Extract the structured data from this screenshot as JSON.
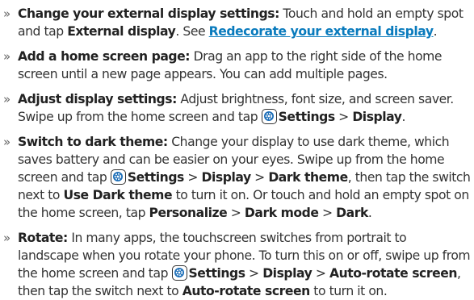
{
  "bullet": "»",
  "items": [
    {
      "title": "Change your external display settings:",
      "t1": " Touch and hold an empty spot and tap ",
      "b1": "External display",
      "t2": ". See ",
      "link": "Redecorate your external display",
      "t3": "."
    },
    {
      "title": "Add a home screen page:",
      "t1": " Drag an app to the right side of the home screen until a new page appears. You can add multiple pages."
    },
    {
      "title": "Adjust display settings:",
      "t1": " Adjust brightness, font size, and screen saver. Swipe up from the home screen and tap ",
      "b1": "Settings",
      "t2": " > ",
      "b2": "Display",
      "t3": "."
    },
    {
      "title": "Switch to dark theme:",
      "t1": " Change your display to use dark theme, which saves battery and can be easier on your eyes. Swipe up from the home screen and tap ",
      "b1": "Settings",
      "t2": " > ",
      "b2": "Display",
      "t3": " > ",
      "b3": "Dark theme",
      "t4": ", then tap the switch next to ",
      "b4": "Use Dark theme",
      "t5": " to turn it on. Or touch and hold an empty spot on the home screen, tap ",
      "b5": "Personalize",
      "t6": " > ",
      "b6": "Dark mode",
      "t7": " > ",
      "b7": "Dark",
      "t8": "."
    },
    {
      "title": "Rotate:",
      "t1": " In many apps, the touchscreen switches from portrait to landscape when you rotate your phone. To turn this on or off, swipe up from the home screen and tap ",
      "b1": "Settings",
      "t2": " > ",
      "b2": "Display",
      "t3": " > ",
      "b3": "Auto-rotate screen",
      "t4": ", then tap the switch next to ",
      "b4": "Auto-rotate screen",
      "t5": " to turn it on."
    }
  ],
  "icon_name": "settings-gear-icon",
  "colors": {
    "link": "#0a7bbd",
    "icon_fill": "#1e6fb8"
  }
}
